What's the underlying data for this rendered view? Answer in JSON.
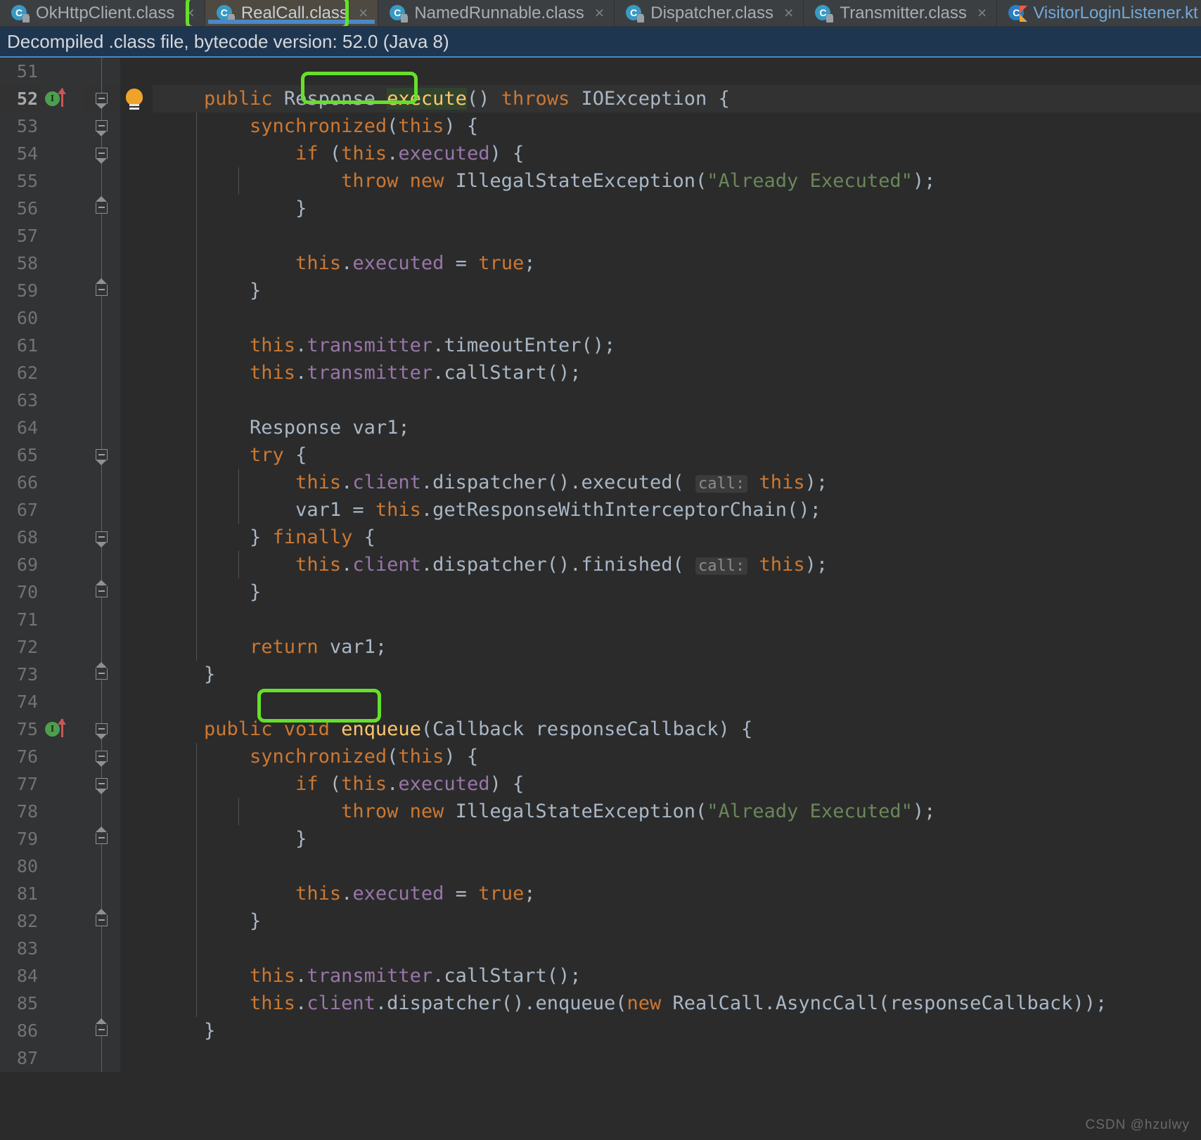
{
  "tabs": [
    {
      "label": "OkHttpClient.class",
      "icon": "java-class-icon",
      "active": false,
      "kind": "class"
    },
    {
      "label": "RealCall.class",
      "icon": "java-class-icon",
      "active": true,
      "kind": "class"
    },
    {
      "label": "NamedRunnable.class",
      "icon": "java-class-icon",
      "active": false,
      "kind": "class"
    },
    {
      "label": "Dispatcher.class",
      "icon": "java-class-icon",
      "active": false,
      "kind": "class"
    },
    {
      "label": "Transmitter.class",
      "icon": "java-class-icon",
      "active": false,
      "kind": "class"
    },
    {
      "label": "VisitorLoginListener.kt",
      "icon": "kotlin-file-icon",
      "active": false,
      "kind": "kt"
    }
  ],
  "tab_close_glyph": "×",
  "notice": {
    "text": "Decompiled .class file, bytecode version: 52.0 (Java 8)"
  },
  "gutter": {
    "implementation_marker": "I",
    "override_arrow": "up-arrow",
    "intention_bulb": "lightbulb"
  },
  "editor": {
    "current_line": 52,
    "selected_text": "execute",
    "parameter_hint": "call:",
    "lines": [
      {
        "n": 51,
        "text": ""
      },
      {
        "n": 52,
        "text": "    public Response execute() throws IOException {"
      },
      {
        "n": 53,
        "text": "        synchronized(this) {"
      },
      {
        "n": 54,
        "text": "            if (this.executed) {"
      },
      {
        "n": 55,
        "text": "                throw new IllegalStateException(\"Already Executed\");"
      },
      {
        "n": 56,
        "text": "            }"
      },
      {
        "n": 57,
        "text": ""
      },
      {
        "n": 58,
        "text": "            this.executed = true;"
      },
      {
        "n": 59,
        "text": "        }"
      },
      {
        "n": 60,
        "text": ""
      },
      {
        "n": 61,
        "text": "        this.transmitter.timeoutEnter();"
      },
      {
        "n": 62,
        "text": "        this.transmitter.callStart();"
      },
      {
        "n": 63,
        "text": ""
      },
      {
        "n": 64,
        "text": "        Response var1;"
      },
      {
        "n": 65,
        "text": "        try {"
      },
      {
        "n": 66,
        "text": "            this.client.dispatcher().executed( call: this);"
      },
      {
        "n": 67,
        "text": "            var1 = this.getResponseWithInterceptorChain();"
      },
      {
        "n": 68,
        "text": "        } finally {"
      },
      {
        "n": 69,
        "text": "            this.client.dispatcher().finished( call: this);"
      },
      {
        "n": 70,
        "text": "        }"
      },
      {
        "n": 71,
        "text": ""
      },
      {
        "n": 72,
        "text": "        return var1;"
      },
      {
        "n": 73,
        "text": "    }"
      },
      {
        "n": 74,
        "text": ""
      },
      {
        "n": 75,
        "text": "    public void enqueue(Callback responseCallback) {"
      },
      {
        "n": 76,
        "text": "        synchronized(this) {"
      },
      {
        "n": 77,
        "text": "            if (this.executed) {"
      },
      {
        "n": 78,
        "text": "                throw new IllegalStateException(\"Already Executed\");"
      },
      {
        "n": 79,
        "text": "            }"
      },
      {
        "n": 80,
        "text": ""
      },
      {
        "n": 81,
        "text": "            this.executed = true;"
      },
      {
        "n": 82,
        "text": "        }"
      },
      {
        "n": 83,
        "text": ""
      },
      {
        "n": 84,
        "text": "        this.transmitter.callStart();"
      },
      {
        "n": 85,
        "text": "        this.client.dispatcher().enqueue(new RealCall.AsyncCall(responseCallback));"
      },
      {
        "n": 86,
        "text": "    }"
      },
      {
        "n": 87,
        "text": ""
      }
    ]
  },
  "annotations": [
    {
      "name": "tab-highlight",
      "target": "RealCall.class tab"
    },
    {
      "name": "execute-method-highlight",
      "target": "execute"
    },
    {
      "name": "enqueue-method-highlight",
      "target": "enqueue"
    }
  ],
  "watermark": {
    "text": "CSDN @hzulwy"
  },
  "colors": {
    "editor_background": "#2b2b2b",
    "gutter_background": "#313335",
    "current_line": "#323232",
    "notice_background": "#1f3650",
    "tab_active_background": "#4e4a41",
    "tab_underline": "#4a88c7",
    "annotation_green": "#66e02a",
    "keyword": "#cc7832",
    "string": "#6a8759",
    "method": "#ffc66d",
    "field": "#9876aa",
    "plain": "#a9b7c6"
  }
}
